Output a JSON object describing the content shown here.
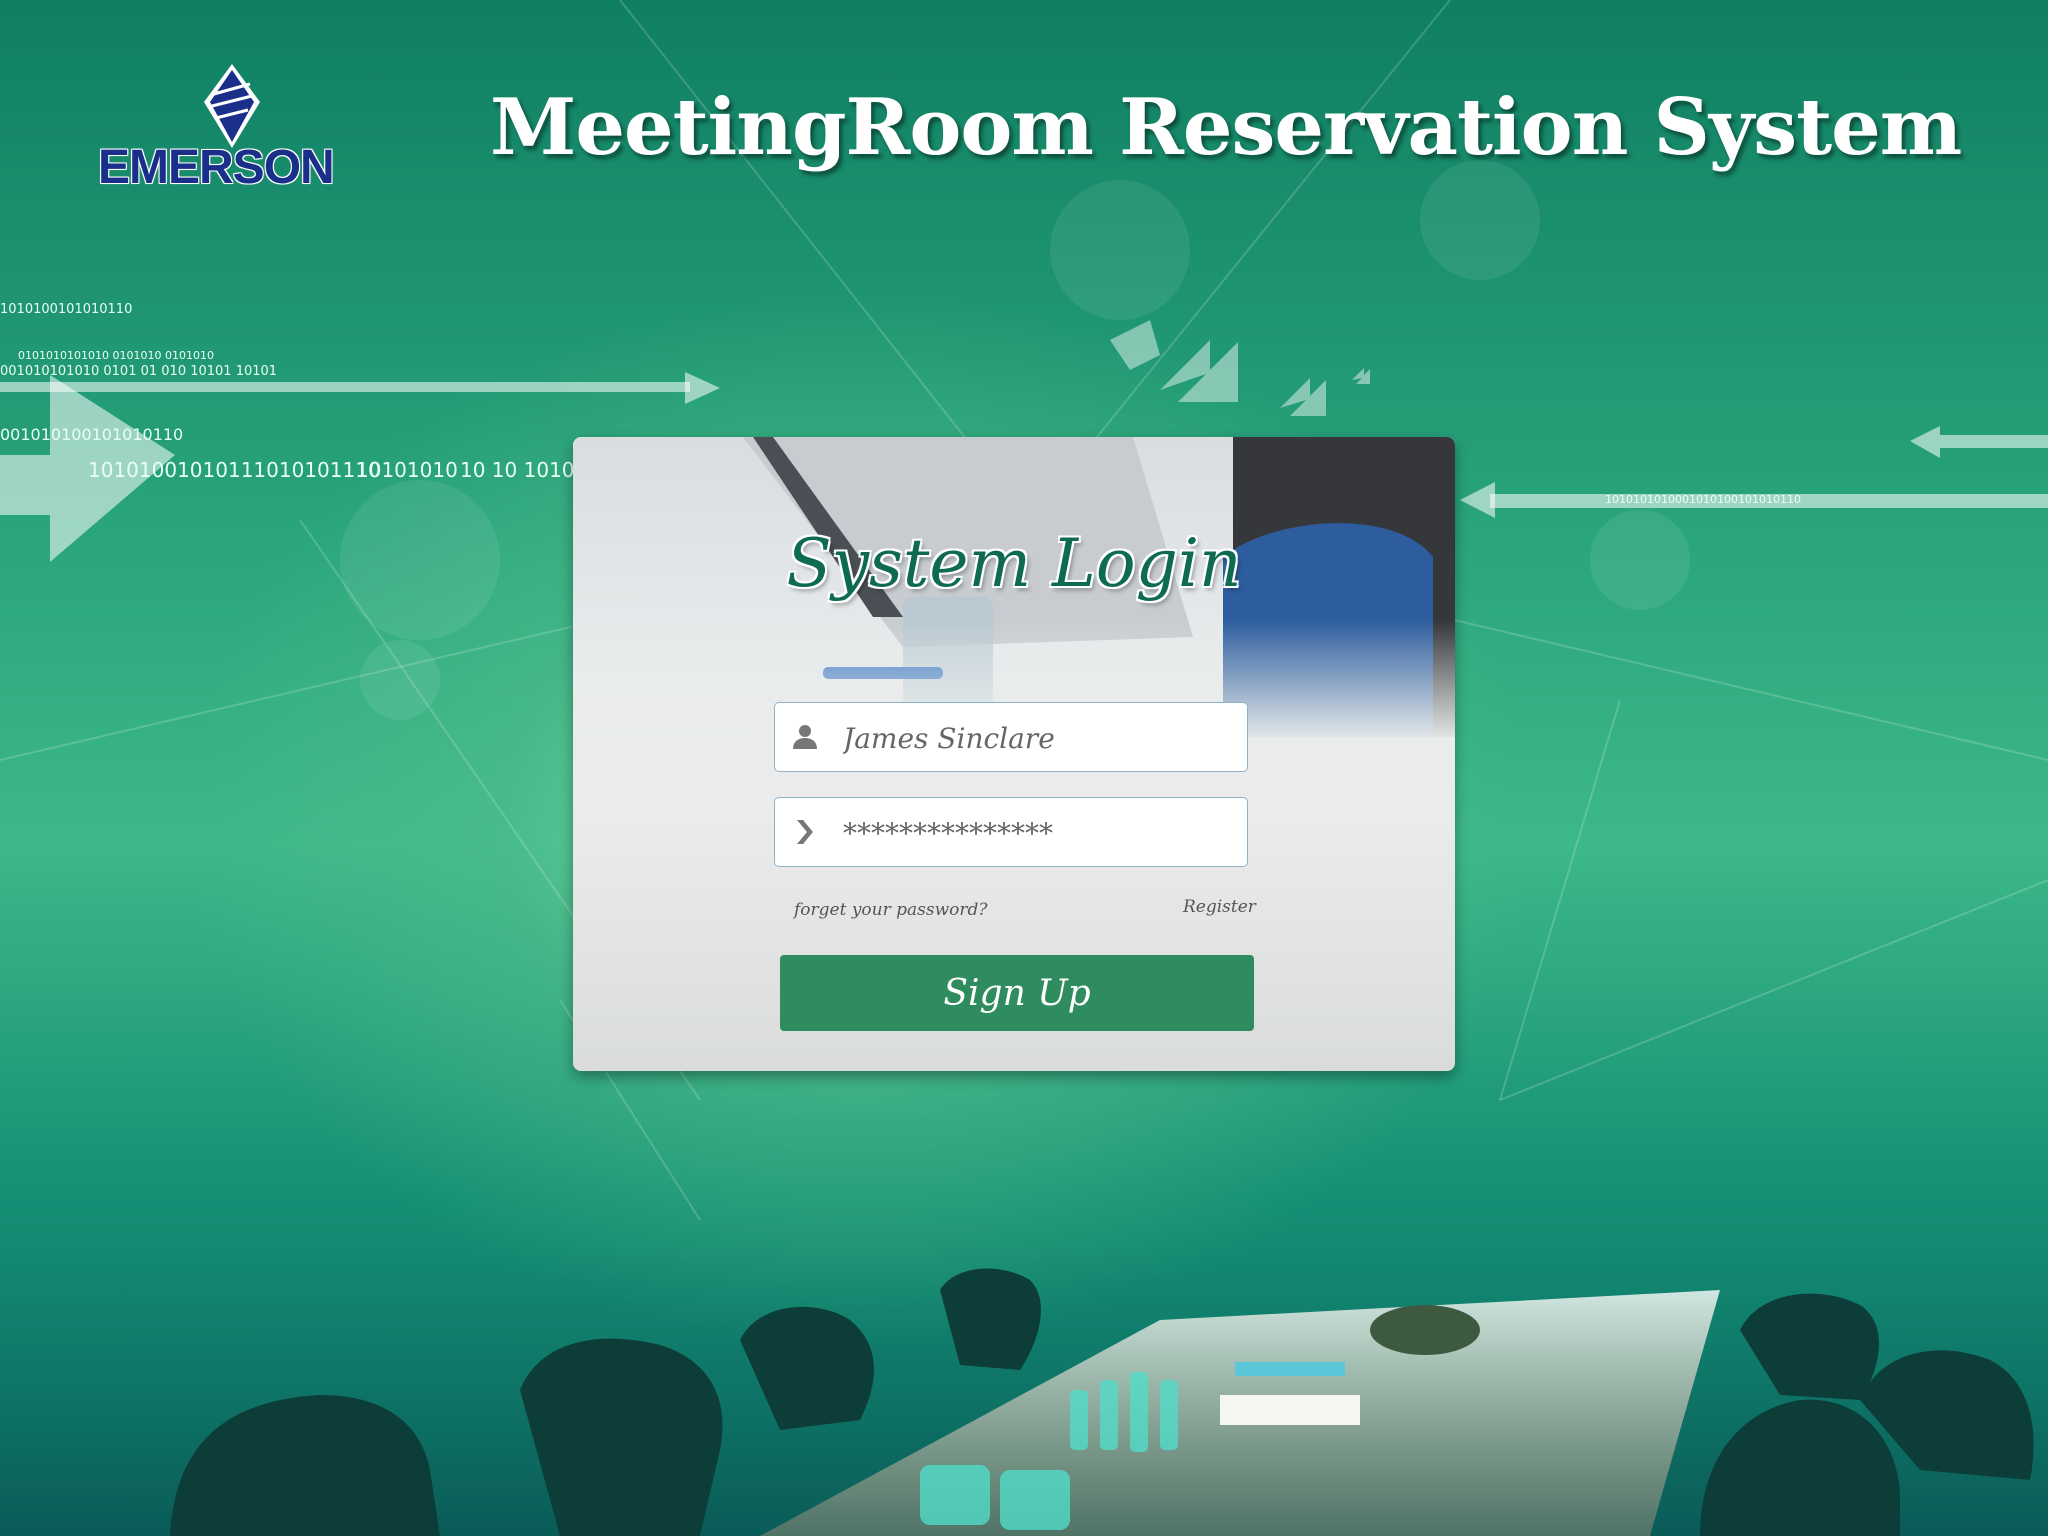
{
  "header": {
    "logo_text": "EMERSON",
    "title": "MeetingRoom Reservation System"
  },
  "decor": {
    "binary_lines": [
      "1010100101010110",
      "0101010101010 0101010 0101010",
      "001010101010 0101 01 010 10101 10101",
      "001010100101010110",
      "10101001010111010101110",
      "10101010",
      "10 10 101010",
      "1010101010001010100101010110"
    ]
  },
  "login": {
    "title": "System Login",
    "username": {
      "value": "James Sinclare",
      "icon": "user-icon"
    },
    "password": {
      "value": "***************",
      "icon": "chevron-right-icon"
    },
    "forgot_label": "forget your password?",
    "register_label": "Register",
    "signup_label": "Sign Up"
  },
  "colors": {
    "accent_green": "#2e8c5e",
    "title_green": "#0f6a52",
    "logo_blue": "#1a2f8a"
  }
}
